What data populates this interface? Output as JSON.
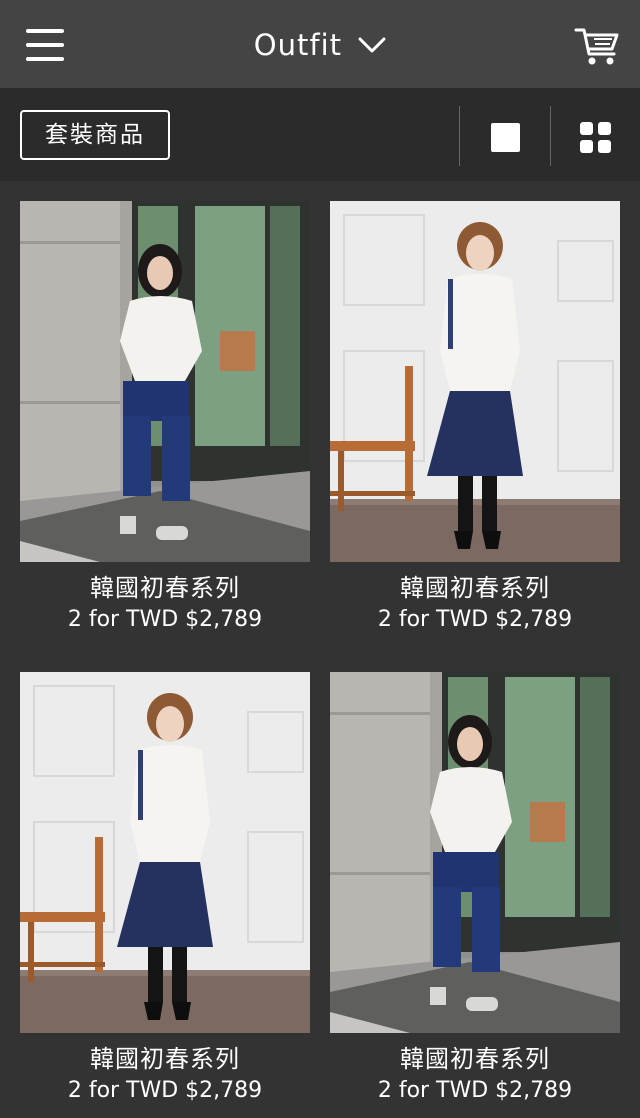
{
  "header": {
    "title": "Outfit",
    "menu_icon": "hamburger-menu-icon",
    "dropdown_icon": "chevron-down-icon",
    "cart_icon": "shopping-cart-icon"
  },
  "filter_bar": {
    "category_label": "套裝商品",
    "single_view_icon": "single-column-view-icon",
    "grid_view_icon": "grid-view-icon"
  },
  "products": [
    {
      "name": "韓國初春系列",
      "price": "2 for TWD $2,789"
    },
    {
      "name": "韓國初春系列",
      "price": "2 for TWD $2,789"
    },
    {
      "name": "韓國初春系列",
      "price": "2 for TWD $2,789"
    },
    {
      "name": "韓國初春系列",
      "price": "2 for TWD $2,789"
    }
  ],
  "colors": {
    "header_bg": "#444444",
    "filter_bg": "#2b2b2b",
    "page_bg": "#333333",
    "text": "#ffffff"
  }
}
